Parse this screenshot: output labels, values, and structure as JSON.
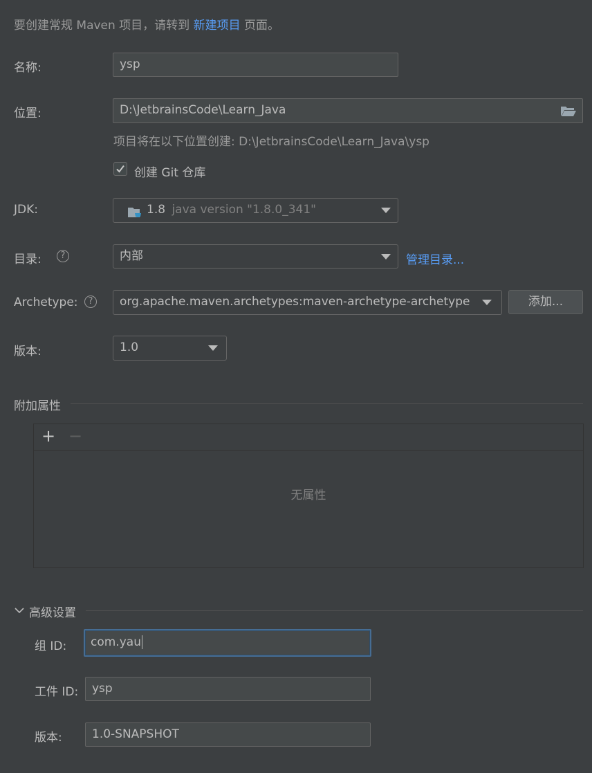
{
  "hint": {
    "prefix": "要创建常规 Maven 项目，请转到",
    "link": "新建项目",
    "suffix": "页面。"
  },
  "name": {
    "label": "名称:",
    "value": "ysp"
  },
  "location": {
    "label": "位置:",
    "value": "D:\\JetbrainsCode\\Learn_Java",
    "note": "项目将在以下位置创建: D:\\JetbrainsCode\\Learn_Java\\ysp",
    "icon": "folder-open-icon"
  },
  "git": {
    "checked": true,
    "label": "创建 Git 仓库"
  },
  "jdk": {
    "label": "JDK:",
    "version": "1.8",
    "detail": "java version \"1.8.0_341\""
  },
  "catalog": {
    "label": "目录:",
    "value": "内部",
    "manage_link": "管理目录..."
  },
  "archetype": {
    "label": "Archetype:",
    "value": "org.apache.maven.archetypes:maven-archetype-archetype",
    "add_button": "添加..."
  },
  "version": {
    "label": "版本:",
    "value": "1.0"
  },
  "properties": {
    "title": "附加属性",
    "add": "+",
    "remove": "−",
    "empty": "无属性"
  },
  "advanced": {
    "title": "高级设置",
    "group_id": {
      "label": "组 ID:",
      "value": "com.yau"
    },
    "artifact_id": {
      "label": "工件 ID:",
      "value": "ysp"
    },
    "version": {
      "label": "版本:",
      "value": "1.0-SNAPSHOT"
    }
  },
  "colors": {
    "background": "#3c3f41",
    "link": "#589df6",
    "focus_border": "#466d94"
  }
}
